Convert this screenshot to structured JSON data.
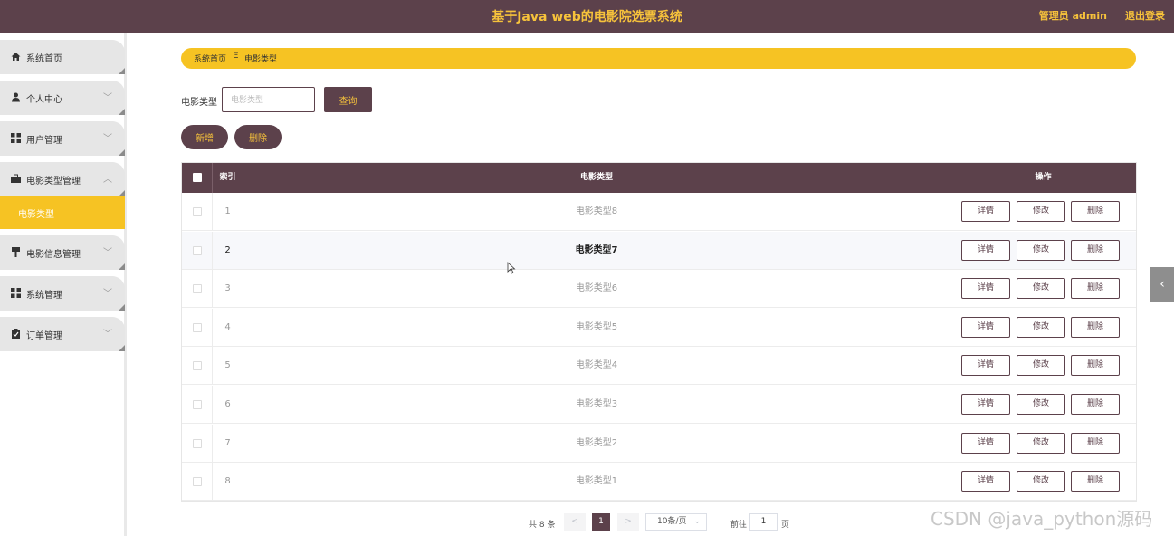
{
  "header": {
    "title": "基于Java web的电影院选票系统",
    "user": "管理员 admin",
    "logout": "退出登录"
  },
  "sidebar": {
    "items": [
      {
        "label": "系统首页",
        "icon": "home-icon"
      },
      {
        "label": "个人中心",
        "icon": "person-icon"
      },
      {
        "label": "用户管理",
        "icon": "grid-icon"
      },
      {
        "label": "电影类型管理",
        "icon": "briefcase-icon"
      },
      {
        "label": "电影信息管理",
        "icon": "pin-icon"
      },
      {
        "label": "系统管理",
        "icon": "grid-icon"
      },
      {
        "label": "订单管理",
        "icon": "clipboard-icon"
      }
    ],
    "active_sub": "电影类型"
  },
  "breadcrumb": {
    "home": "系统首页",
    "separator": "Ξ",
    "current": "电影类型"
  },
  "search": {
    "label": "电影类型",
    "placeholder": "电影类型",
    "button": "查询"
  },
  "actions": {
    "add": "新增",
    "delete": "删除"
  },
  "table": {
    "headers": {
      "index": "索引",
      "type": "电影类型",
      "ops": "操作"
    },
    "rows": [
      {
        "index": "1",
        "type": "电影类型8"
      },
      {
        "index": "2",
        "type": "电影类型7"
      },
      {
        "index": "3",
        "type": "电影类型6"
      },
      {
        "index": "4",
        "type": "电影类型5"
      },
      {
        "index": "5",
        "type": "电影类型4"
      },
      {
        "index": "6",
        "type": "电影类型3"
      },
      {
        "index": "7",
        "type": "电影类型2"
      },
      {
        "index": "8",
        "type": "电影类型1"
      }
    ],
    "row_actions": {
      "detail": "详情",
      "edit": "修改",
      "delete": "删除"
    }
  },
  "pagination": {
    "total": "共 8 条",
    "prev": "<",
    "current": "1",
    "next": ">",
    "page_size": "10条/页",
    "goto_label": "前往",
    "goto_value": "1",
    "page_suffix": "页"
  },
  "side_tab": "‹",
  "watermark": "CSDN @java_python源码",
  "colors": {
    "primary": "#5c414b",
    "accent": "#f6c323"
  }
}
